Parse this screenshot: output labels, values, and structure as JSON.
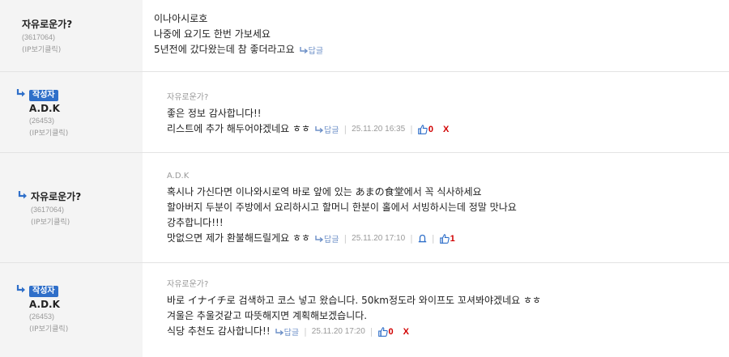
{
  "labels": {
    "reply": "답글",
    "ipview": "(IP보기클릭)",
    "author_badge": "작성자",
    "delete": "X"
  },
  "comments": [
    {
      "nickname": "자유로운가?",
      "uid": "(3617064)",
      "lines": [
        "이나아시로호",
        "나중에 요기도 한번 가보세요",
        "5년전에 갔다왔는데 참 좋더라고요"
      ]
    },
    {
      "nickname": "A.D.K",
      "uid": "(26453)",
      "reply_to": "자유로운가?",
      "lines": [
        "좋은 정보 감사합니다!!",
        "리스트에 추가 해두어야겠네요 ㅎㅎ"
      ],
      "date": "25.11.20 16:35",
      "likes": "0"
    },
    {
      "nickname": "자유로운가?",
      "uid": "(3617064)",
      "reply_to": "A.D.K",
      "lines": [
        "혹시나 가신다면 이나와시로역 바로 앞에 있는 あまの食堂에서 꼭 식사하세요",
        "할아버지 두분이 주방에서 요리하시고 할머니 한분이 홀에서 서빙하시는데 정말 맛나요",
        "강추합니다!!!",
        "맛없으면 제가 환불해드릴게요 ㅎㅎ"
      ],
      "date": "25.11.20 17:10",
      "likes": "1"
    },
    {
      "nickname": "A.D.K",
      "uid": "(26453)",
      "reply_to": "자유로운가?",
      "lines": [
        "바로 イナイチ로 검색하고 코스 넣고 왔습니다. 50km정도라 와이프도 꼬셔봐야겠네요 ㅎㅎ",
        "겨울은 추울것같고 따뜻해지면 계획해보겠습니다.",
        "식당 추천도 감사합니다!!"
      ],
      "date": "25.11.20 17:20",
      "likes": "0"
    }
  ]
}
